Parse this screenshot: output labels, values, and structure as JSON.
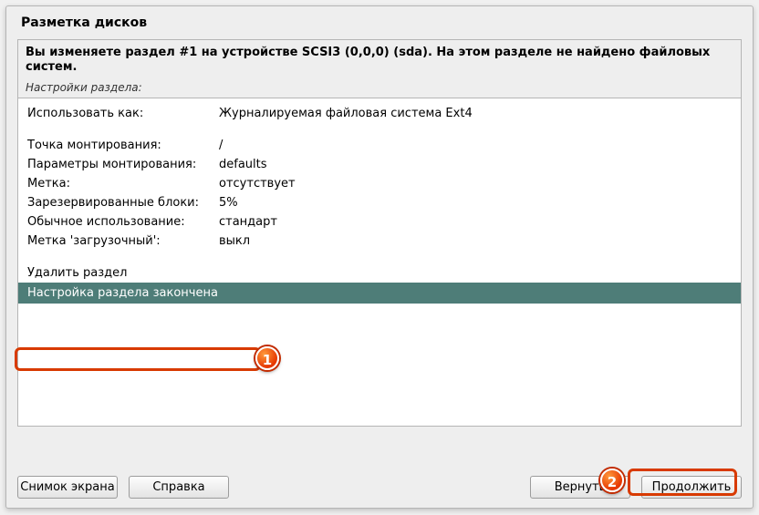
{
  "title": "Разметка дисков",
  "description": "Вы изменяете раздел #1 на устройстве SCSI3 (0,0,0) (sda). На этом разделе не найдено файловых систем.",
  "subdescription": "Настройки раздела:",
  "settings": [
    {
      "label": "Использовать как:",
      "value": "Журналируемая файловая система Ext4"
    },
    {
      "label": "",
      "value": ""
    },
    {
      "label": "Точка монтирования:",
      "value": "/"
    },
    {
      "label": "Параметры монтирования:",
      "value": "defaults"
    },
    {
      "label": "Метка:",
      "value": "отсутствует"
    },
    {
      "label": "Зарезервированные блоки:",
      "value": "5%"
    },
    {
      "label": "Обычное использование:",
      "value": "стандарт"
    },
    {
      "label": "Метка 'загрузочный':",
      "value": "выкл"
    }
  ],
  "actions": {
    "delete": "Удалить раздел",
    "done": "Настройка раздела закончена"
  },
  "buttons": {
    "screenshot": "Снимок экрана",
    "help": "Справка",
    "back": "Вернуть",
    "continue": "Продолжить"
  },
  "callouts": {
    "one": "1",
    "two": "2"
  }
}
